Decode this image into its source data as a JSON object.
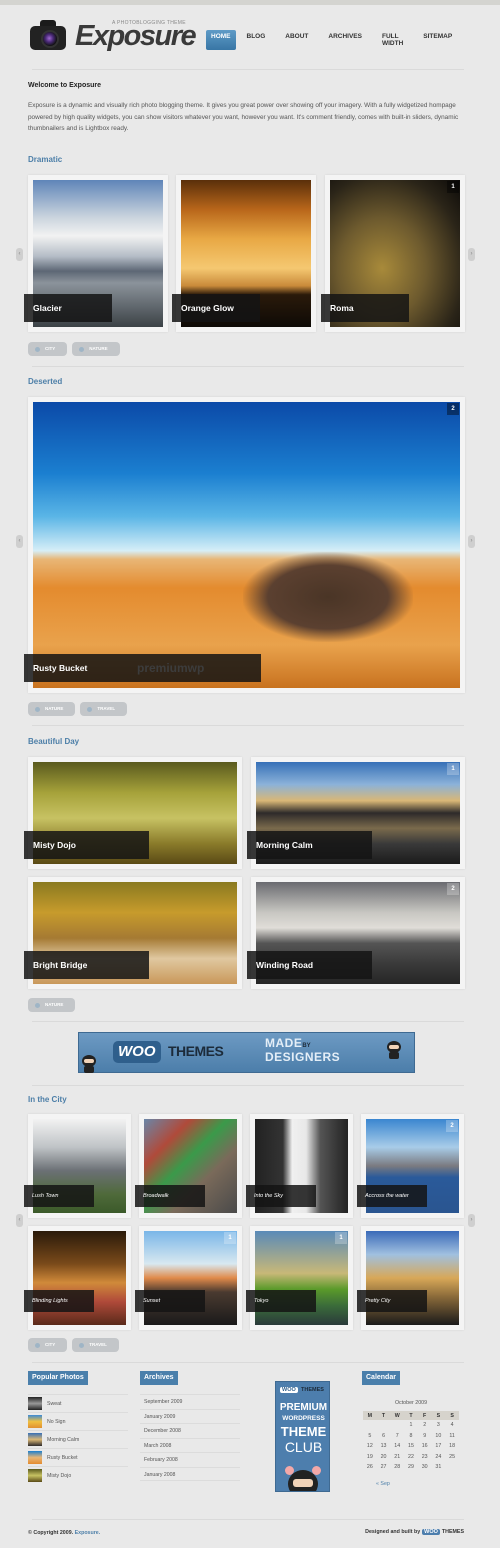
{
  "header": {
    "logo_title": "Exposure",
    "logo_tagline": "A PHOTOBLOGGING THEME",
    "nav": [
      {
        "label": "HOME",
        "active": true
      },
      {
        "label": "BLOG",
        "active": false
      },
      {
        "label": "ABOUT",
        "active": false
      },
      {
        "label": "ARCHIVES",
        "active": false
      },
      {
        "label": "FULL WIDTH",
        "active": false
      },
      {
        "label": "SITEMAP",
        "active": false
      }
    ]
  },
  "intro": {
    "title": "Welcome to Exposure",
    "text": "Exposure is a dynamic and visually rich photo blogging theme. It gives you great power over showing off your imagery. With a fully widgetized hompage powered by high quality widgets, you can show visitors whatever you want, however you want. It's comment friendly, comes with built-in sliders, dynamic thumbnailers and is Lightbox ready."
  },
  "sections": [
    {
      "title": "Dramatic",
      "photos": [
        {
          "caption": "Glacier",
          "badge": ""
        },
        {
          "caption": "Orange Glow",
          "badge": ""
        },
        {
          "caption": "Roma",
          "badge": "1"
        }
      ],
      "tags": [
        "CITY",
        "NATURE"
      ]
    },
    {
      "title": "Deserted",
      "photos": [
        {
          "caption": "Rusty Bucket",
          "badge": "2",
          "watermark": "premiumwp"
        }
      ],
      "tags": [
        "NATURE",
        "TRAVEL"
      ]
    },
    {
      "title": "Beautiful Day",
      "photos": [
        {
          "caption": "Misty Dojo",
          "badge": ""
        },
        {
          "caption": "Morning Calm",
          "badge": "1"
        },
        {
          "caption": "Bright Bridge",
          "badge": ""
        },
        {
          "caption": "Winding Road",
          "badge": "2"
        }
      ],
      "tags": [
        "NATURE"
      ]
    },
    {
      "title": "In the City",
      "photos": [
        {
          "caption": "Lush Town",
          "badge": ""
        },
        {
          "caption": "Broadwalk",
          "badge": ""
        },
        {
          "caption": "Into the Sky",
          "badge": ""
        },
        {
          "caption": "Accross the water",
          "badge": "2"
        },
        {
          "caption": "Blinding Lights",
          "badge": ""
        },
        {
          "caption": "Sunset",
          "badge": "1"
        },
        {
          "caption": "Tokyo",
          "badge": "1"
        },
        {
          "caption": "Pretty City",
          "badge": ""
        }
      ],
      "tags": [
        "CITY",
        "TRAVEL"
      ]
    }
  ],
  "ad_banner": {
    "woo": "WOO",
    "themes": "THEMES",
    "made": "MADE",
    "by": "BY",
    "designers": "DESIGNERS"
  },
  "widgets": {
    "popular": {
      "title": "Popular Photos",
      "items": [
        "Sweat",
        "No Sign",
        "Morning Calm",
        "Rusty Bucket",
        "Misty Dojo"
      ]
    },
    "archives": {
      "title": "Archives",
      "items": [
        "September 2009",
        "January 2009",
        "December 2008",
        "March 2008",
        "February 2008",
        "January 2008"
      ]
    },
    "club_ad": {
      "woo": "WOO",
      "themes": "THEMES",
      "line1": "PREMIUM",
      "line2": "WORDPRESS",
      "line3": "THEME",
      "line4": "CLUB"
    },
    "calendar": {
      "title": "Calendar",
      "caption": "October 2009",
      "days": [
        "M",
        "T",
        "W",
        "T",
        "F",
        "S",
        "S"
      ],
      "weeks": [
        [
          "",
          "",
          "",
          "1",
          "2",
          "3",
          "4"
        ],
        [
          "5",
          "6",
          "7",
          "8",
          "9",
          "10",
          "11"
        ],
        [
          "12",
          "13",
          "14",
          "15",
          "16",
          "17",
          "18"
        ],
        [
          "19",
          "20",
          "21",
          "22",
          "23",
          "24",
          "25"
        ],
        [
          "26",
          "27",
          "28",
          "29",
          "30",
          "31",
          ""
        ]
      ],
      "prev_link": "« Sep"
    }
  },
  "footer": {
    "copyright": "© Copyright 2009.",
    "site_link": "Exposure.",
    "credit": "Designed and built by",
    "woo": "WOO",
    "themes": "THEMES"
  }
}
